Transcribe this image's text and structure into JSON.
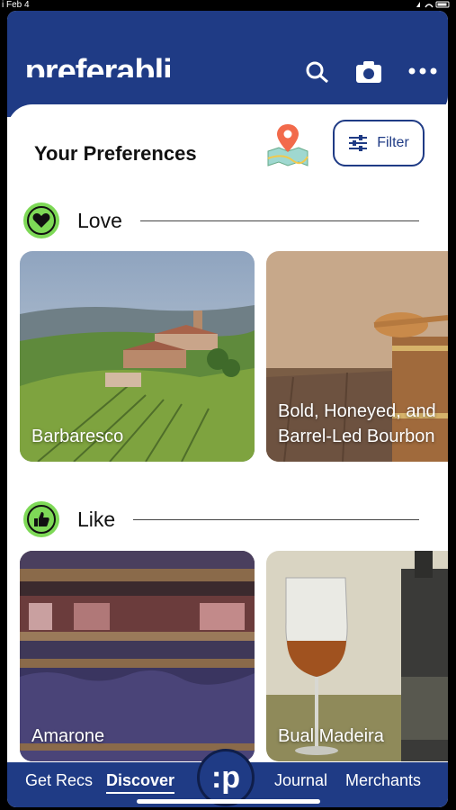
{
  "status": {
    "time": "i Feb 4"
  },
  "app": {
    "name": "preferabli",
    "logo_dot": "•",
    "logo_rest": "preferabli"
  },
  "header": {
    "title": "Your Preferences",
    "filter_label": "Filter"
  },
  "sections": [
    {
      "label": "Love",
      "cards": [
        {
          "caption": "Barbaresco"
        },
        {
          "caption_line1": "Bold, Honeyed, and",
          "caption_line2": "Barrel-Led Bourbon"
        }
      ]
    },
    {
      "label": "Like",
      "cards": [
        {
          "caption": "Amarone"
        },
        {
          "caption": "Bual Madeira"
        }
      ]
    }
  ],
  "nav": {
    "get_recs": "Get Recs",
    "discover": "Discover",
    "fab": ":p",
    "journal": "Journal",
    "merchants": "Merchants"
  },
  "colors": {
    "brand": "#1f3b85",
    "accent": "#7ed957"
  }
}
